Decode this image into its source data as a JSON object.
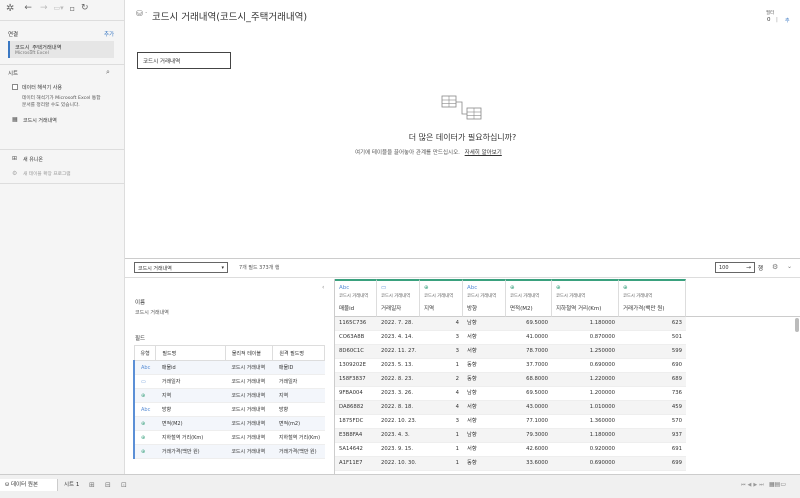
{
  "app": {
    "datasource_title": "코드시 거래내역(코드시_주택거래내역)",
    "top_right": {
      "label": "필터",
      "count": "0",
      "sep": "|",
      "sub": "추"
    }
  },
  "sidebar": {
    "connections_header": "연결",
    "add_label": "추가",
    "connection_name": "코드시_주택거래내역",
    "connection_type": "Microsoft Excel",
    "sheets_header": "시트",
    "interpreter_label": "데이터 해석기 사용",
    "interpreter_desc_1": "데이터 해석기가 Microsoft Excel 통합",
    "interpreter_desc_2": "문서를 정리할 수도 있습니다.",
    "sheet_item": "코드시 거래내역",
    "new_union": "새 유니온",
    "new_table_ext": "새 테이블 확장 프로그램"
  },
  "canvas": {
    "table_box": "코드시 거래내역",
    "prompt_title": "더 많은 데이터가 필요하십니까?",
    "prompt_desc": "여기에 테이블을 끌어놓아 관계를 만드십시오.",
    "prompt_link": "자세히 알아보기"
  },
  "toolbar": {
    "table_select": "코드시 거래내역",
    "summary": "7개 필드 373개 행",
    "rows_value": "100",
    "rows_label": "행"
  },
  "meta": {
    "name_label": "이름",
    "name_value": "코드시 거래내역",
    "fields_label": "필드",
    "headers": [
      "유형",
      "필드명",
      "물리적 테이블",
      "원격 필드명"
    ],
    "rows": [
      {
        "type": "Abc",
        "field": "매물id",
        "table": "코드시 거래내역",
        "remote": "매물ID"
      },
      {
        "type": "▭",
        "field": "거래일자",
        "table": "코드시 거래내역",
        "remote": "거래일자"
      },
      {
        "type": "⊕",
        "field": "지역",
        "table": "코드시 거래내역",
        "remote": "지역"
      },
      {
        "type": "Abc",
        "field": "방향",
        "table": "코드시 거래내역",
        "remote": "방향"
      },
      {
        "type": "⊕",
        "field": "면적(M2)",
        "table": "코드시 거래내역",
        "remote": "면적(m2)"
      },
      {
        "type": "⊕",
        "field": "지하철역 거리(Km)",
        "table": "코드시 거래내역",
        "remote": "지하철역 거리(Km)"
      },
      {
        "type": "⊕",
        "field": "거래가격(백만 원)",
        "table": "코드시 거래내역",
        "remote": "거래가격(백만 원)"
      }
    ]
  },
  "grid": {
    "columns": [
      {
        "type": "Abc",
        "source": "코드시 거래내역",
        "name": "매물id"
      },
      {
        "type": "▭",
        "source": "코드시 거래내역",
        "name": "거래일자"
      },
      {
        "type": "⊕",
        "source": "코드시 거래내역",
        "name": "지역"
      },
      {
        "type": "Abc",
        "source": "코드시 거래내역",
        "name": "방향"
      },
      {
        "type": "⊕",
        "source": "코드시 거래내역",
        "name": "면적(M2)"
      },
      {
        "type": "⊕",
        "source": "코드시 거래내역",
        "name": "지하철역 거리(Km)"
      },
      {
        "type": "⊕",
        "source": "코드시 거래내역",
        "name": "거래가격(백만 원)"
      }
    ],
    "rows": [
      [
        "1165C736",
        "2022. 7. 28.",
        "4",
        "남향",
        "69.5000",
        "1.180000",
        "623"
      ],
      [
        "CO63A8B",
        "2023. 4. 14.",
        "3",
        "서향",
        "41.0000",
        "0.870000",
        "501"
      ],
      [
        "8D60C1C",
        "2022. 11. 27.",
        "3",
        "서향",
        "78.7000",
        "1.250000",
        "599"
      ],
      [
        "1309202E",
        "2023. 5. 13.",
        "1",
        "동향",
        "37.7000",
        "0.690000",
        "690"
      ],
      [
        "158F3837",
        "2022. 8. 23.",
        "2",
        "동향",
        "68.8000",
        "1.220000",
        "689"
      ],
      [
        "9FBA004",
        "2023. 3. 26.",
        "4",
        "남향",
        "69.5000",
        "1.200000",
        "736"
      ],
      [
        "DA86882",
        "2022. 8. 18.",
        "4",
        "서향",
        "43.0000",
        "1.010000",
        "459"
      ],
      [
        "1875FDC",
        "2022. 10. 23.",
        "3",
        "서향",
        "77.1000",
        "1.360000",
        "570"
      ],
      [
        "E3B8FA4",
        "2023. 4. 3.",
        "1",
        "남향",
        "79.3000",
        "1.180000",
        "937"
      ],
      [
        "5A14642",
        "2023. 9. 15.",
        "1",
        "서향",
        "42.6000",
        "0.920000",
        "691"
      ],
      [
        "A1F11E7",
        "2022. 10. 30.",
        "1",
        "동향",
        "33.6000",
        "0.690000",
        "699"
      ]
    ]
  },
  "status": {
    "datasource_tab": "데이터 원본",
    "sheet_tab": "시트 1"
  }
}
